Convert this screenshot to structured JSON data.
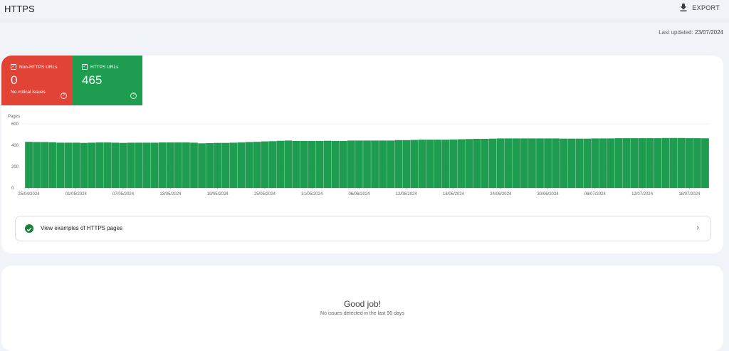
{
  "header": {
    "title": "HTTPS",
    "export_label": "EXPORT"
  },
  "last_updated": {
    "label": "Last updated:",
    "value": "23/07/2024"
  },
  "tiles": [
    {
      "label": "Non-HTTPS URLs",
      "value": "0",
      "sub": "No critical issues",
      "color": "#e14337"
    },
    {
      "label": "HTTPS URLs",
      "value": "465",
      "sub": "",
      "color": "#1e9c4f"
    }
  ],
  "examples": {
    "label": "View examples of HTTPS pages"
  },
  "summary": {
    "title": "Good job!",
    "subtitle": "No issues detected in the last 90 days"
  },
  "chart_data": {
    "type": "bar",
    "ylabel": "Pages",
    "ylim": [
      0,
      600
    ],
    "yticks": [
      "0",
      "200",
      "400",
      "600"
    ],
    "xtick_labels": [
      "25/04/2024",
      "01/05/2024",
      "07/05/2024",
      "13/05/2024",
      "19/05/2024",
      "25/05/2024",
      "31/05/2024",
      "06/06/2024",
      "12/06/2024",
      "18/06/2024",
      "24/06/2024",
      "30/06/2024",
      "06/07/2024",
      "12/07/2024",
      "18/07/2024"
    ],
    "series": [
      {
        "color": "#1e9c4f",
        "values": [
          432,
          430,
          430,
          428,
          424,
          424,
          424,
          422,
          424,
          426,
          426,
          424,
          422,
          424,
          424,
          424,
          424,
          426,
          426,
          426,
          426,
          424,
          418,
          420,
          422,
          422,
          424,
          426,
          430,
          432,
          436,
          438,
          442,
          444,
          440,
          440,
          440,
          440,
          442,
          440,
          440,
          444,
          444,
          444,
          444,
          444,
          444,
          448,
          448,
          450,
          452,
          452,
          452,
          452,
          454,
          456,
          458,
          460,
          460,
          462,
          464,
          464,
          464,
          464,
          464,
          464,
          464,
          464,
          462,
          462,
          462,
          462,
          464,
          464,
          464,
          466,
          466,
          466,
          466,
          466,
          466,
          468,
          468,
          468,
          466,
          466,
          465
        ]
      }
    ]
  }
}
